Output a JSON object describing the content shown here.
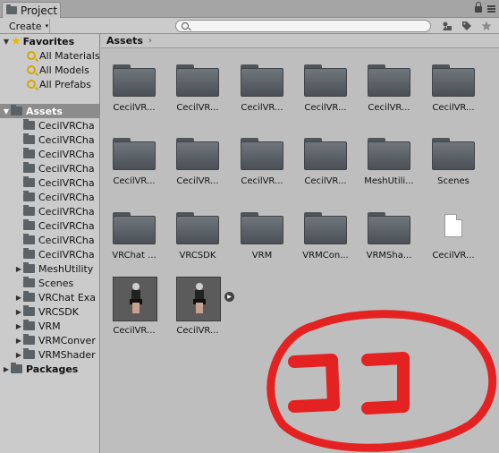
{
  "window": {
    "tab_label": "Project",
    "icons": [
      "lock-icon",
      "menu-icon"
    ]
  },
  "toolbar": {
    "create_label": "Create",
    "create_caret": "▾",
    "search_value": "",
    "icons": [
      "filter-by-type-icon",
      "filter-by-label-icon",
      "favorite-star-icon"
    ]
  },
  "sidebar": {
    "favorites": {
      "label": "Favorites",
      "items": [
        "All Materials",
        "All Models",
        "All Prefabs"
      ]
    },
    "assets": {
      "label": "Assets",
      "children": [
        {
          "label": "CecilVRCha",
          "expandable": false
        },
        {
          "label": "CecilVRCha",
          "expandable": false
        },
        {
          "label": "CecilVRCha",
          "expandable": false
        },
        {
          "label": "CecilVRCha",
          "expandable": false
        },
        {
          "label": "CecilVRCha",
          "expandable": false
        },
        {
          "label": "CecilVRCha",
          "expandable": false
        },
        {
          "label": "CecilVRCha",
          "expandable": false
        },
        {
          "label": "CecilVRCha",
          "expandable": false
        },
        {
          "label": "CecilVRCha",
          "expandable": false
        },
        {
          "label": "CecilVRCha",
          "expandable": false
        },
        {
          "label": "MeshUtility",
          "expandable": true
        },
        {
          "label": "Scenes",
          "expandable": false
        },
        {
          "label": "VRChat Exa",
          "expandable": true
        },
        {
          "label": "VRCSDK",
          "expandable": true
        },
        {
          "label": "VRM",
          "expandable": true
        },
        {
          "label": "VRMConver",
          "expandable": true
        },
        {
          "label": "VRMShader",
          "expandable": true
        }
      ]
    },
    "packages": {
      "label": "Packages"
    }
  },
  "main": {
    "breadcrumb": "Assets",
    "breadcrumb_chevron": "›",
    "items": [
      {
        "label": "CecilVR...",
        "kind": "folder"
      },
      {
        "label": "CecilVR...",
        "kind": "folder"
      },
      {
        "label": "CecilVR...",
        "kind": "folder"
      },
      {
        "label": "CecilVR...",
        "kind": "folder"
      },
      {
        "label": "CecilVR...",
        "kind": "folder"
      },
      {
        "label": "CecilVR...",
        "kind": "folder"
      },
      {
        "label": "CecilVR...",
        "kind": "folder"
      },
      {
        "label": "CecilVR...",
        "kind": "folder"
      },
      {
        "label": "CecilVR...",
        "kind": "folder"
      },
      {
        "label": "CecilVR...",
        "kind": "folder"
      },
      {
        "label": "MeshUtili...",
        "kind": "folder"
      },
      {
        "label": "Scenes",
        "kind": "folder"
      },
      {
        "label": "VRChat ...",
        "kind": "folder"
      },
      {
        "label": "VRCSDK",
        "kind": "folder"
      },
      {
        "label": "VRM",
        "kind": "folder"
      },
      {
        "label": "VRMCon...",
        "kind": "folder"
      },
      {
        "label": "VRMSha...",
        "kind": "folder"
      },
      {
        "label": "CecilVR...",
        "kind": "file"
      },
      {
        "label": "CecilVR...",
        "kind": "model-prefab"
      },
      {
        "label": "CecilVR...",
        "kind": "model",
        "expand_glyph": "▶"
      }
    ]
  },
  "annotation": {
    "text": "ココ",
    "color": "#e52222"
  }
}
